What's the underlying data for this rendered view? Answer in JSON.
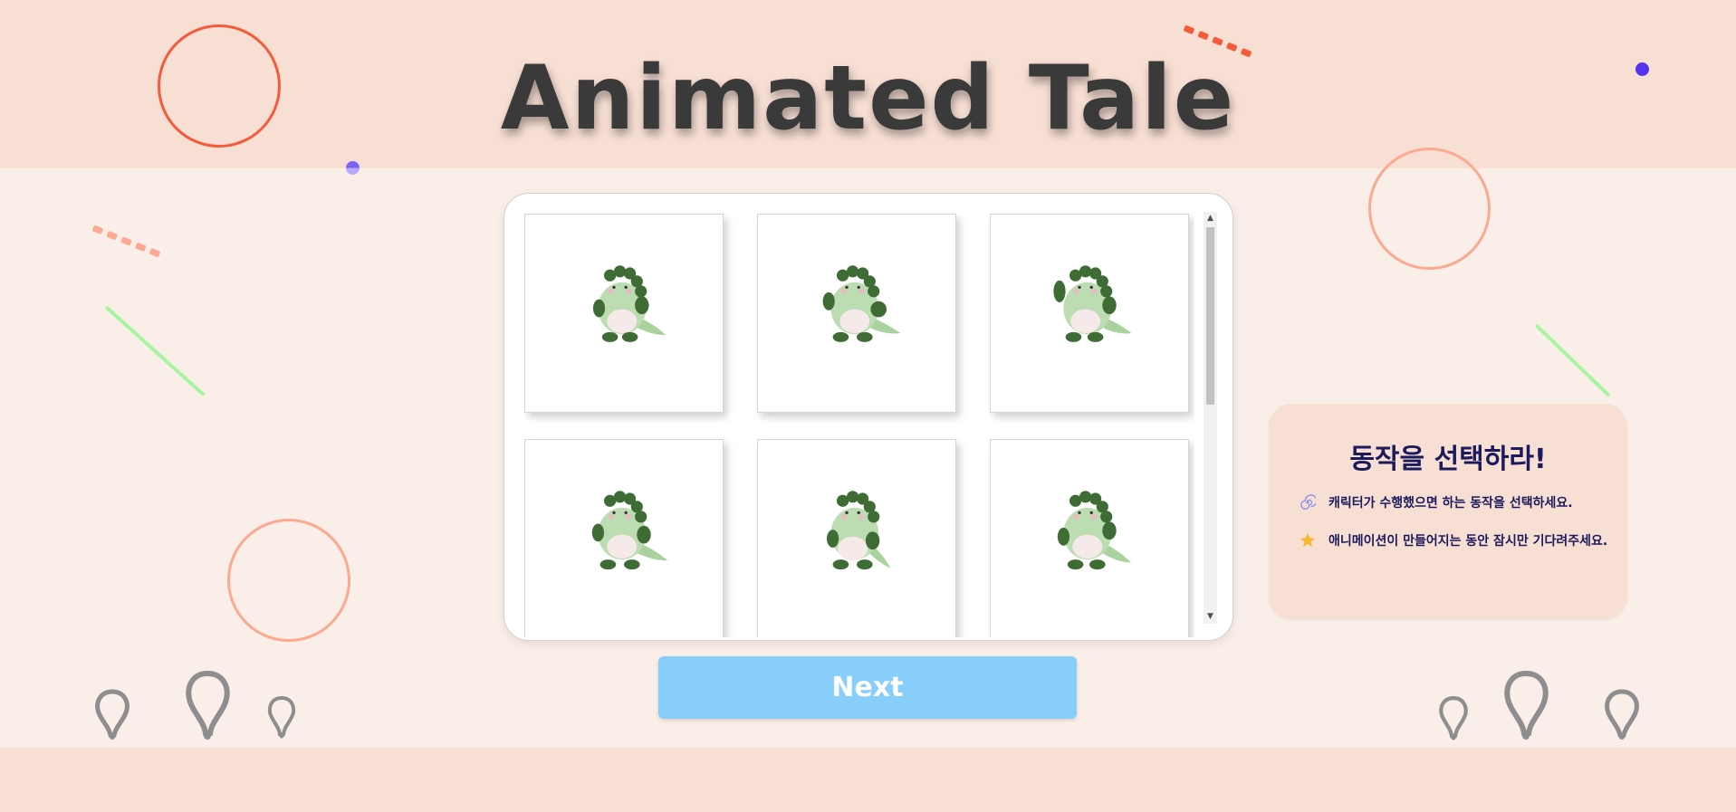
{
  "app": {
    "title": "Animated Tale"
  },
  "grid": {
    "items": [
      {
        "name": "dino-pose-1"
      },
      {
        "name": "dino-pose-2"
      },
      {
        "name": "dino-pose-3"
      },
      {
        "name": "dino-pose-4"
      },
      {
        "name": "dino-pose-5"
      },
      {
        "name": "dino-pose-6"
      }
    ]
  },
  "next_button": {
    "label": "Next"
  },
  "info_panel": {
    "title": "동작을 선택하라!",
    "items": [
      {
        "icon": "spiral-icon",
        "text": "캐릭터가 수행했으면 하는 동작을 선택하세요."
      },
      {
        "icon": "star-icon",
        "text": "애니메이션이 만들어지는 동안 잠시만 기다려주세요."
      }
    ]
  },
  "colors": {
    "background": "#faeee8",
    "band": "#f8dfd4",
    "title": "#3a3a3a",
    "accent_orange": "#f45b3a",
    "accent_purple": "#5534f0",
    "accent_green": "#a8f5a0",
    "button": "#87cefa",
    "info_text": "#1b1a5c"
  }
}
